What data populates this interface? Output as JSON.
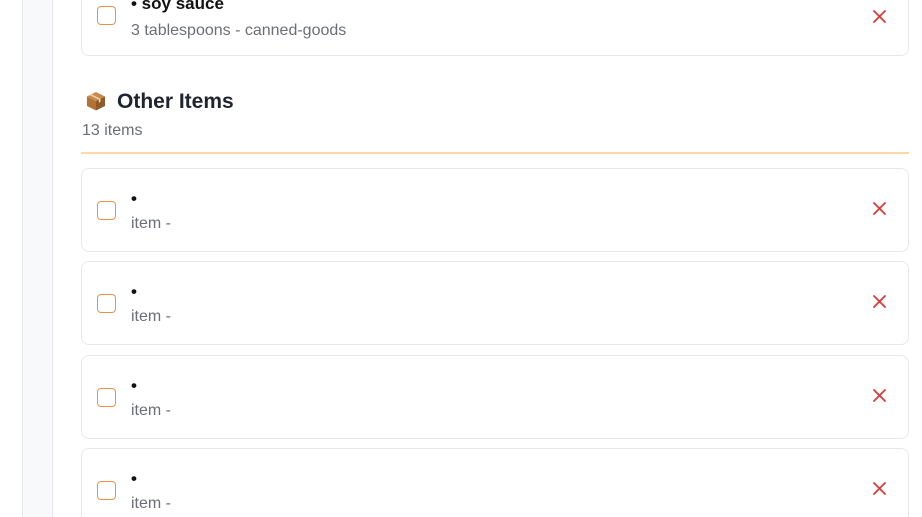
{
  "top_item": {
    "name": "• soy sauce",
    "meta": "3 tablespoons - canned-goods"
  },
  "section": {
    "icon": "package-icon",
    "title": "Other Items",
    "count": "13 items"
  },
  "items": [
    {
      "name": "•",
      "meta": "item -"
    },
    {
      "name": "•",
      "meta": "item -"
    },
    {
      "name": "•",
      "meta": "item -"
    },
    {
      "name": "•",
      "meta": "item -"
    }
  ],
  "colors": {
    "checkbox_border": "#e8914b",
    "delete": "#d93a3a",
    "divider": "#fbd9a5"
  }
}
